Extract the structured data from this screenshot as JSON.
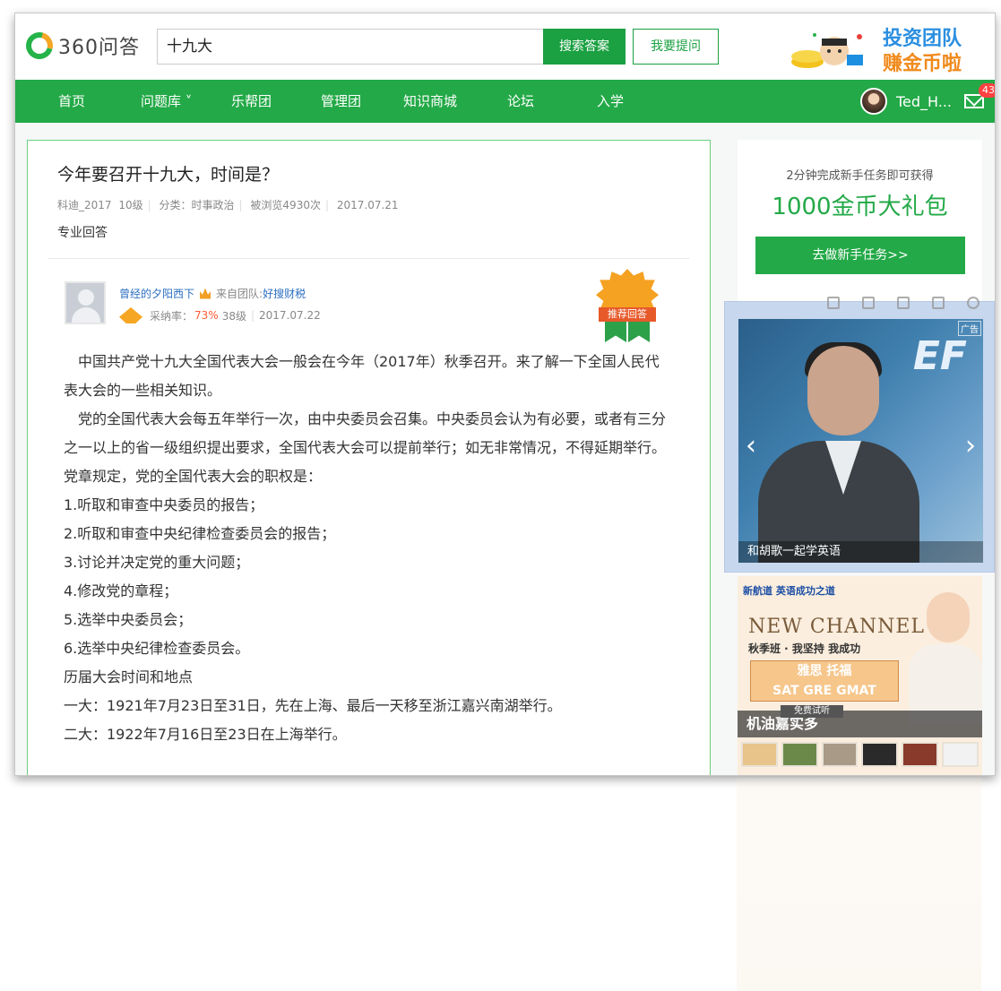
{
  "header": {
    "logo_text": "360问答",
    "search_value": "十九大",
    "search_button": "搜索答案",
    "ask_button": "我要提问",
    "promo_line1": "投资团队",
    "promo_line2": "赚金币啦"
  },
  "nav": {
    "items": [
      "首页",
      "问题库 ˅",
      "乐帮团",
      "管理团",
      "知识商城",
      "论坛",
      "入学"
    ],
    "user_name": "Ted_H...",
    "mail_badge": "43"
  },
  "question": {
    "title": "今年要召开十九大，时间是？",
    "asker": "科迪_2017",
    "asker_level": "10级",
    "category": "分类：时事政治",
    "views": "被浏览4930次",
    "date": "2017.07.21",
    "section_label": "专业回答"
  },
  "answer": {
    "user": "曾经的夕阳西下",
    "team_prefix": "来自团队:",
    "team": "好搜财税",
    "rate_label": "采纳率：",
    "rate": "73%",
    "level": "38级",
    "date": "2017.07.22",
    "badge": "推荐回答",
    "paragraphs": [
      "　中国共产党十九大全国代表大会一般会在今年（2017年）秋季召开。来了解一下全国人民代表大会的一些相关知识。",
      "　党的全国代表大会每五年举行一次，由中央委员会召集。中央委员会认为有必要，或者有三分之一以上的省一级组织提出要求，全国代表大会可以提前举行；如无非常情况，不得延期举行。",
      "党章规定，党的全国代表大会的职权是：",
      "1.听取和审查中央委员的报告；",
      "2.听取和审查中央纪律检查委员会的报告；",
      "3.讨论并决定党的重大问题；",
      "4.修改党的章程；",
      "5.选举中央委员会；",
      "6.选举中央纪律检查委员会。",
      "历届大会时间和地点",
      "一大：1921年7月23日至31日，先在上海、最后一天移至浙江嘉兴南湖举行。",
      "二大：1922年7月16日至23日在上海举行。"
    ]
  },
  "sidebar": {
    "task_sub": "2分钟完成新手任务即可获得",
    "task_main": "1000金币大礼包",
    "task_button": "去做新手任务>>",
    "ad1_brand": "EF",
    "ad1_label": "广告",
    "ad1_caption": "和胡歌一起学英语",
    "ad2_top": "新航道 英语成功之道",
    "ad2_title": "NEW CHANNEL",
    "ad2_sub": "秋季班 · 我坚持 我成功",
    "ad2_courses_1": "雅思 托福",
    "ad2_courses_2": "SAT GRE GMAT",
    "ad2_free": "免费试听",
    "ad2_label": "机油嘉实多"
  },
  "colors": {
    "brand_green": "#23a947",
    "link_blue": "#2b6fc0",
    "rate_orange": "#ff5a33"
  },
  "icons": {
    "logo": "360-logo-icon",
    "mail": "mail-icon",
    "prev": "chevron-left-icon",
    "next": "chevron-right-icon"
  }
}
